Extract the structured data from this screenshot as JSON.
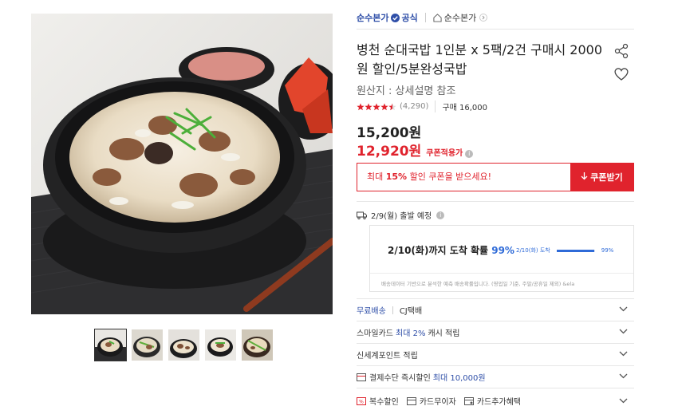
{
  "gallery": {
    "main_image": "gukbap-main-photo",
    "thumbnails": [
      "thumb-1",
      "thumb-2",
      "thumb-3",
      "thumb-4",
      "thumb-5"
    ],
    "active_index": 0
  },
  "brand": {
    "name": "순수본가",
    "official_label": "공식",
    "store_name": "순수본가"
  },
  "product": {
    "title": "병천 순대국밥 1인분 x 5팩/2건 구매시 2000원 할인/5분완성국밥",
    "origin": "원산지 : 상세설명 참조",
    "rating_value": 4.5,
    "review_count": "(4,290)",
    "purchase_count": "구매 16,000"
  },
  "price": {
    "original": "15,200원",
    "sale": "12,920원",
    "coupon_applied_label": "쿠폰적용가"
  },
  "coupon": {
    "prefix": "최대 ",
    "highlight": "15%",
    "suffix": " 할인 쿠폰을 받으세요!",
    "button_label": "쿠폰받기"
  },
  "shipping": {
    "dispatch": "2/9(월) 출발 예정",
    "arrival_prefix": "2/10(화)까지 도착 확률 ",
    "arrival_pct": "99%",
    "mini_date": "2/10(화) 도착",
    "mini_pct": "99%",
    "mini_fraction": 0.99,
    "note": "배송데이터 기반으로 분석한 예측 배송확률입니다. (영업일 기준, 주말/공휴일 제외) &ela"
  },
  "options": {
    "delivery": {
      "free": "무료배송",
      "carrier": "CJ택배"
    },
    "smartcard": {
      "prefix": "스마일카드 ",
      "highlight": "최대 2%",
      "suffix": " 캐시 적립"
    },
    "points": "신세계포인트 적립",
    "payment": {
      "prefix": "결제수단 즉시할인 ",
      "highlight": "최대 10,000원"
    },
    "benefits": [
      "복수할인",
      "카드무이자",
      "카드추가혜택"
    ]
  },
  "colors": {
    "accent_red": "#e0232d",
    "brand_blue": "#2f4fa8",
    "prob_blue": "#2f6bd8"
  }
}
